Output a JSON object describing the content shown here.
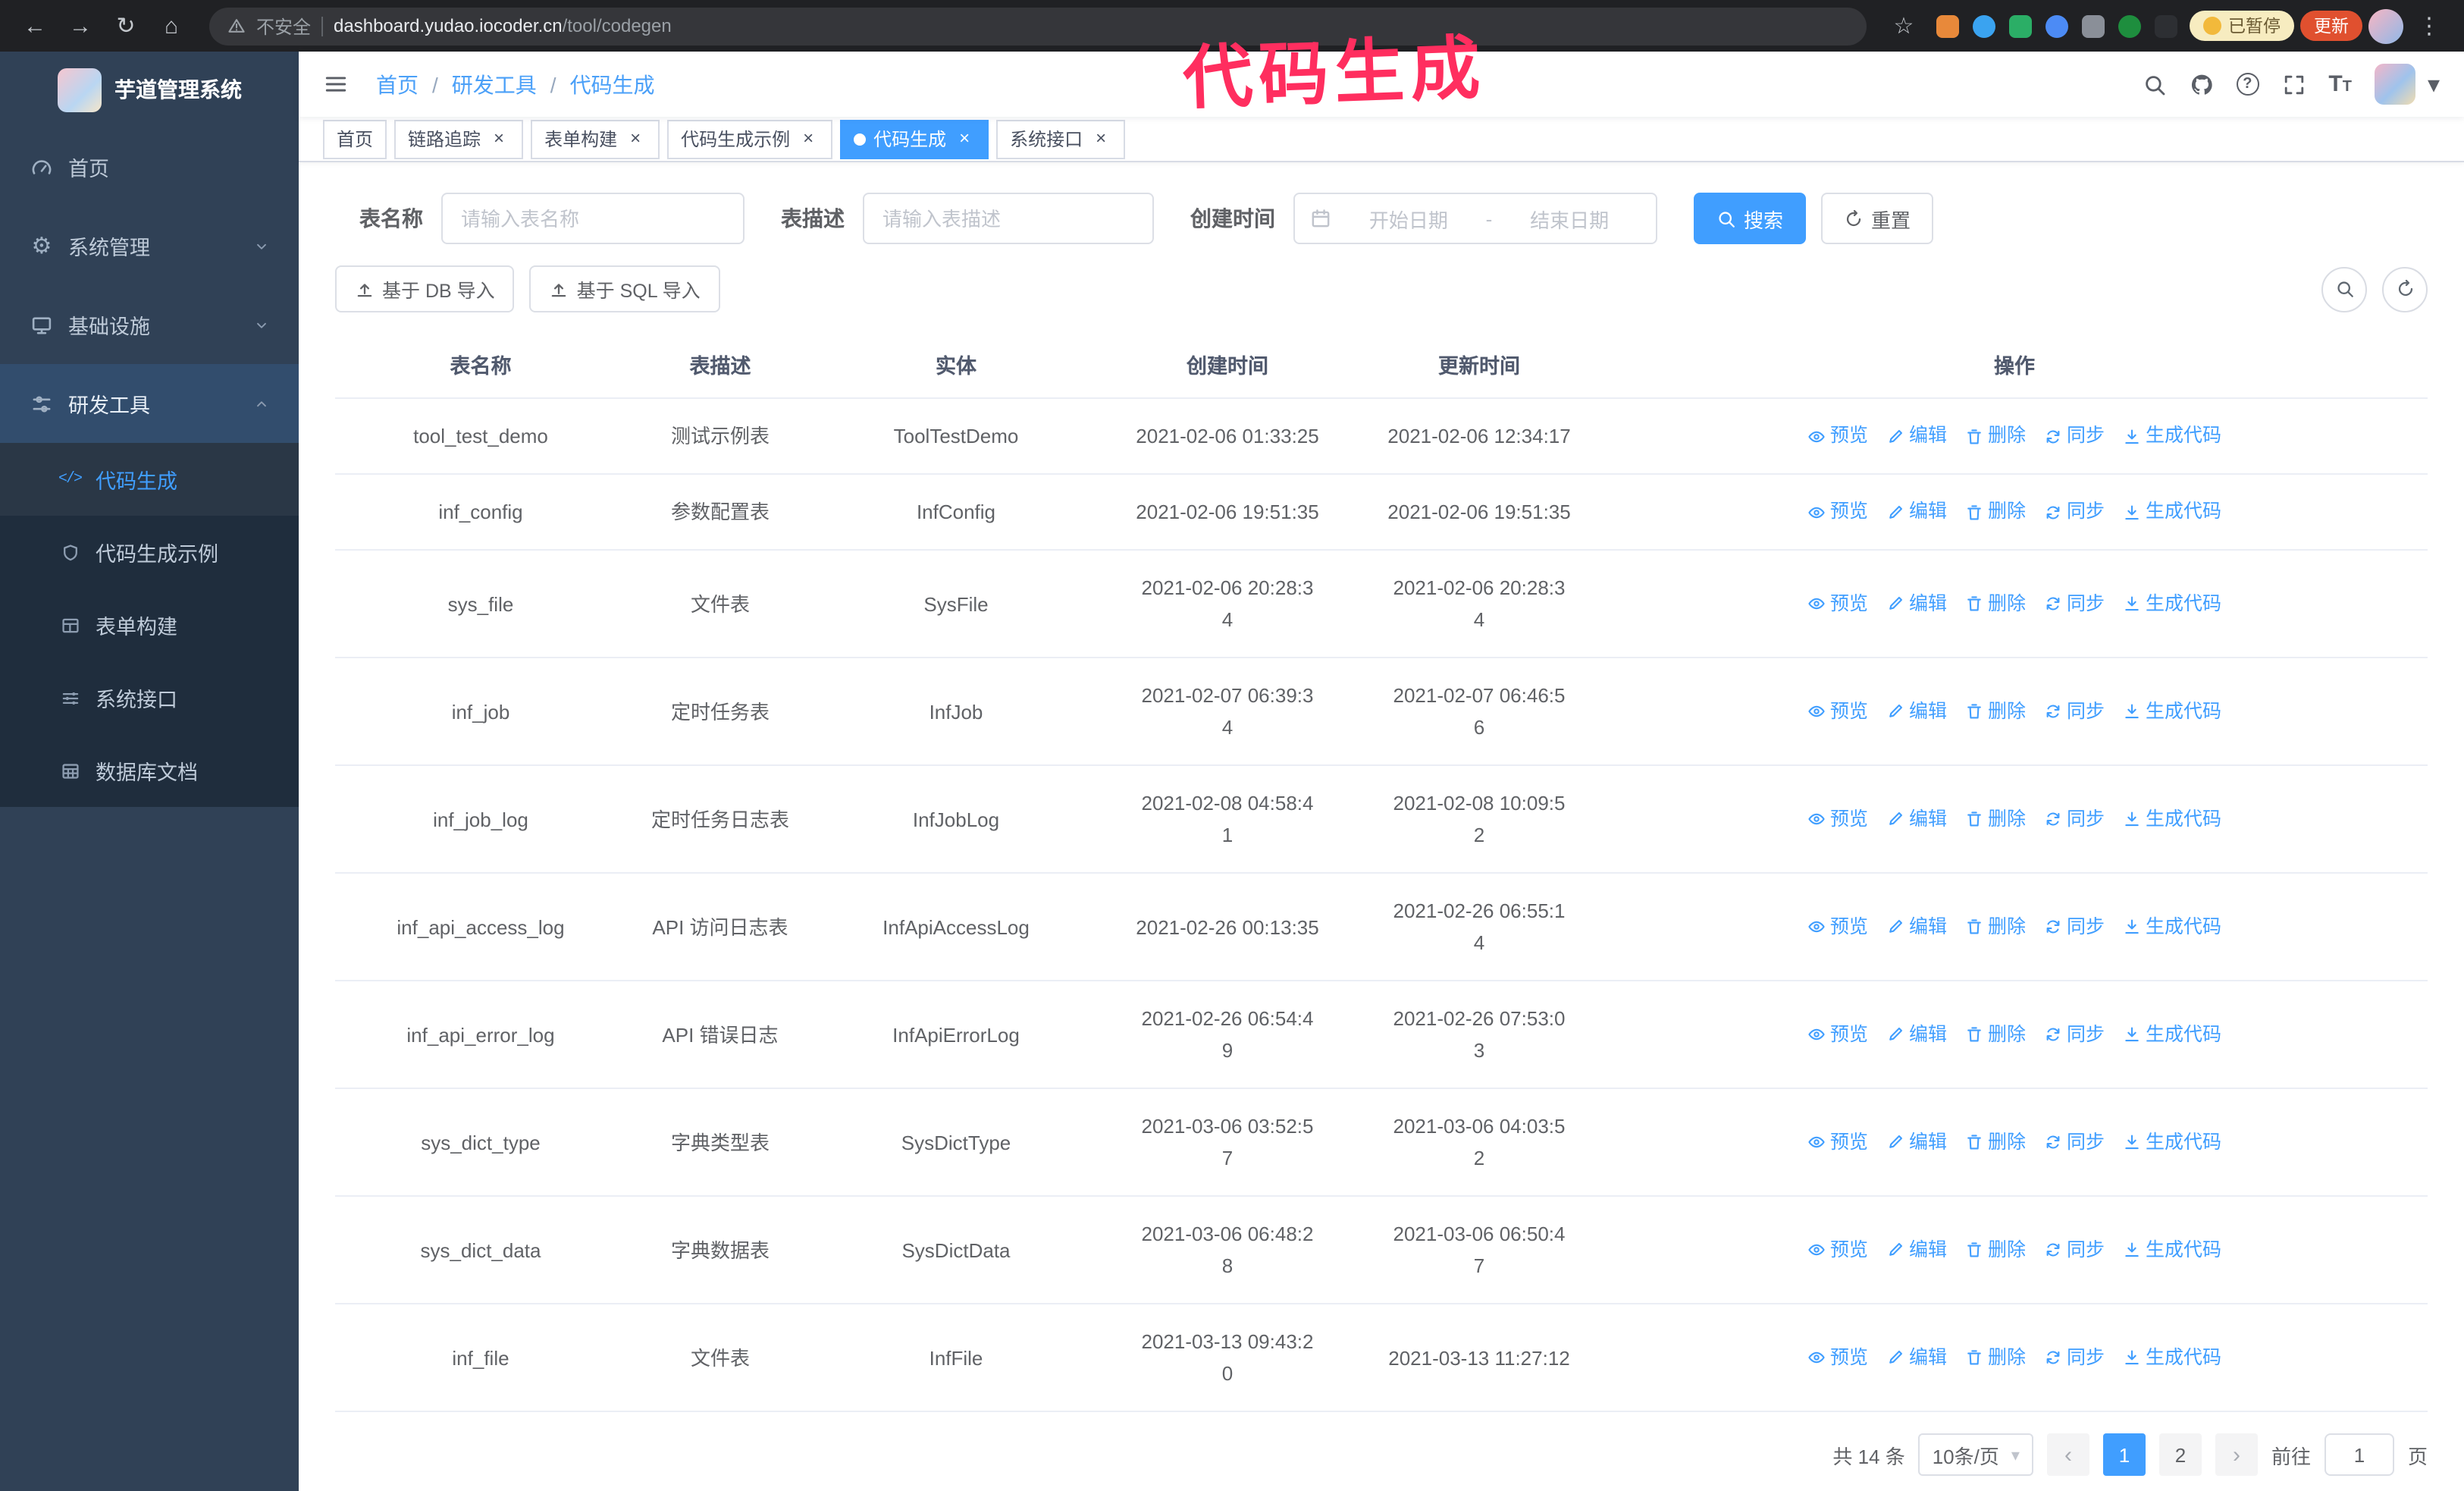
{
  "colors": {
    "accent": "#409eff",
    "sidebar_bg": "#304156",
    "sidebar_submenu_bg": "#1f2d3d",
    "annotation": "#ff2e5f",
    "update_badge_bg": "#e0502f",
    "paused_badge_bg": "#f7ecc0"
  },
  "annotation": {
    "text": "代码生成"
  },
  "browser": {
    "security_label": "不安全",
    "url_domain": "dashboard.yudao.iocoder.cn",
    "url_path": "/tool/codegen",
    "paused_badge": "已暂停",
    "update_button": "更新"
  },
  "sidebar": {
    "logo_title": "芋道管理系统",
    "items": [
      {
        "key": "home",
        "label": "首页",
        "icon": "dashboard-icon",
        "type": "item",
        "expanded": false
      },
      {
        "key": "system",
        "label": "系统管理",
        "icon": "gear-icon",
        "type": "group",
        "expanded": false
      },
      {
        "key": "infra",
        "label": "基础设施",
        "icon": "infra-icon",
        "type": "group",
        "expanded": false
      },
      {
        "key": "dev-tools",
        "label": "研发工具",
        "icon": "tools-icon",
        "type": "group",
        "expanded": true,
        "children": [
          {
            "key": "codegen",
            "label": "代码生成",
            "icon": "code-icon",
            "active": true
          },
          {
            "key": "codegen-demo",
            "label": "代码生成示例",
            "icon": "example-icon",
            "active": false
          },
          {
            "key": "form-builder",
            "label": "表单构建",
            "icon": "form-icon",
            "active": false
          },
          {
            "key": "api-doc",
            "label": "系统接口",
            "icon": "api-icon",
            "active": false
          },
          {
            "key": "db-doc",
            "label": "数据库文档",
            "icon": "dbdoc-icon",
            "active": false
          }
        ]
      }
    ]
  },
  "navbar": {
    "breadcrumb": [
      "首页",
      "研发工具",
      "代码生成"
    ]
  },
  "tabs": [
    {
      "key": "home",
      "label": "首页",
      "closable": false,
      "active": false
    },
    {
      "key": "tracer",
      "label": "链路追踪",
      "closable": true,
      "active": false
    },
    {
      "key": "form-builder",
      "label": "表单构建",
      "closable": true,
      "active": false
    },
    {
      "key": "codegen-demo",
      "label": "代码生成示例",
      "closable": true,
      "active": false
    },
    {
      "key": "codegen",
      "label": "代码生成",
      "closable": true,
      "active": true
    },
    {
      "key": "api-doc",
      "label": "系统接口",
      "closable": true,
      "active": false
    }
  ],
  "filters": {
    "table_name": {
      "label": "表名称",
      "placeholder": "请输入表名称",
      "value": ""
    },
    "table_desc": {
      "label": "表描述",
      "placeholder": "请输入表描述",
      "value": ""
    },
    "create_time": {
      "label": "创建时间",
      "start_placeholder": "开始日期",
      "separator": "-",
      "end_placeholder": "结束日期"
    },
    "search_button": "搜索",
    "reset_button": "重置"
  },
  "toolbar": {
    "import_db_button": "基于 DB 导入",
    "import_sql_button": "基于 SQL 导入"
  },
  "table": {
    "columns": [
      "表名称",
      "表描述",
      "实体",
      "创建时间",
      "更新时间",
      "操作"
    ],
    "actions": [
      {
        "key": "preview",
        "label": "预览",
        "icon": "eye-icon"
      },
      {
        "key": "edit",
        "label": "编辑",
        "icon": "edit-icon"
      },
      {
        "key": "delete",
        "label": "删除",
        "icon": "delete-icon"
      },
      {
        "key": "sync",
        "label": "同步",
        "icon": "sync-icon"
      },
      {
        "key": "generate",
        "label": "生成代码",
        "icon": "download-icon"
      }
    ],
    "rows": [
      {
        "name": "tool_test_demo",
        "desc": "测试示例表",
        "entity": "ToolTestDemo",
        "created": "2021-02-06 01:33:25",
        "updated": "2021-02-06 12:34:17"
      },
      {
        "name": "inf_config",
        "desc": "参数配置表",
        "entity": "InfConfig",
        "created": "2021-02-06 19:51:35",
        "updated": "2021-02-06 19:51:35"
      },
      {
        "name": "sys_file",
        "desc": "文件表",
        "entity": "SysFile",
        "created": "2021-02-06 20:28:3\n4",
        "updated": "2021-02-06 20:28:3\n4"
      },
      {
        "name": "inf_job",
        "desc": "定时任务表",
        "entity": "InfJob",
        "created": "2021-02-07 06:39:3\n4",
        "updated": "2021-02-07 06:46:5\n6"
      },
      {
        "name": "inf_job_log",
        "desc": "定时任务日志表",
        "entity": "InfJobLog",
        "created": "2021-02-08 04:58:4\n1",
        "updated": "2021-02-08 10:09:5\n2"
      },
      {
        "name": "inf_api_access_log",
        "desc": "API 访问日志表",
        "entity": "InfApiAccessLog",
        "created": "2021-02-26 00:13:35",
        "updated": "2021-02-26 06:55:1\n4"
      },
      {
        "name": "inf_api_error_log",
        "desc": "API 错误日志",
        "entity": "InfApiErrorLog",
        "created": "2021-02-26 06:54:4\n9",
        "updated": "2021-02-26 07:53:0\n3"
      },
      {
        "name": "sys_dict_type",
        "desc": "字典类型表",
        "entity": "SysDictType",
        "created": "2021-03-06 03:52:5\n7",
        "updated": "2021-03-06 04:03:5\n2"
      },
      {
        "name": "sys_dict_data",
        "desc": "字典数据表",
        "entity": "SysDictData",
        "created": "2021-03-06 06:48:2\n8",
        "updated": "2021-03-06 06:50:4\n7"
      },
      {
        "name": "inf_file",
        "desc": "文件表",
        "entity": "InfFile",
        "created": "2021-03-13 09:43:2\n0",
        "updated": "2021-03-13 11:27:12"
      }
    ]
  },
  "pagination": {
    "total": "共 14 条",
    "page_size": "10条/页",
    "prev_icon": "‹",
    "next_icon": "›",
    "pages": [
      "1",
      "2"
    ],
    "active_page": "1",
    "goto_label": "前往",
    "goto_value": "1",
    "unit_label": "页"
  }
}
